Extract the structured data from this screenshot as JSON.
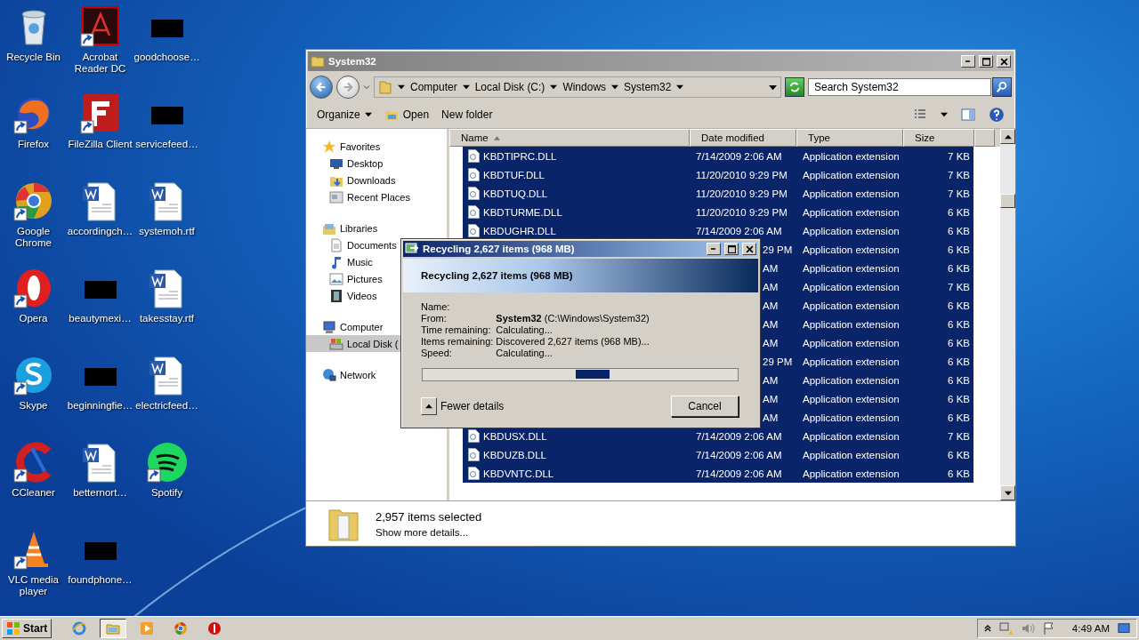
{
  "desktop_icons": [
    {
      "label": "Recycle Bin",
      "kind": "recycle",
      "shortcut": false
    },
    {
      "label": "Acrobat Reader DC",
      "kind": "acrobat",
      "shortcut": true
    },
    {
      "label": "goodchoose…",
      "kind": "blank",
      "shortcut": false
    },
    {
      "label": "Firefox",
      "kind": "firefox",
      "shortcut": true
    },
    {
      "label": "FileZilla Client",
      "kind": "filezilla",
      "shortcut": true
    },
    {
      "label": "servicefeed…",
      "kind": "blank",
      "shortcut": false
    },
    {
      "label": "Google Chrome",
      "kind": "chrome",
      "shortcut": true
    },
    {
      "label": "accordingch…",
      "kind": "word",
      "shortcut": false
    },
    {
      "label": "systemoh.rtf",
      "kind": "word",
      "shortcut": false
    },
    {
      "label": "Opera",
      "kind": "opera",
      "shortcut": true
    },
    {
      "label": "beautymexi…",
      "kind": "blank",
      "shortcut": false
    },
    {
      "label": "takesstay.rtf",
      "kind": "word",
      "shortcut": false
    },
    {
      "label": "Skype",
      "kind": "skype",
      "shortcut": true
    },
    {
      "label": "beginningfie…",
      "kind": "blank",
      "shortcut": false
    },
    {
      "label": "electricfeed…",
      "kind": "word",
      "shortcut": false
    },
    {
      "label": "CCleaner",
      "kind": "ccleaner",
      "shortcut": true
    },
    {
      "label": "betternort…",
      "kind": "word",
      "shortcut": false
    },
    {
      "label": "Spotify",
      "kind": "spotify",
      "shortcut": true
    },
    {
      "label": "VLC media player",
      "kind": "vlc",
      "shortcut": true
    },
    {
      "label": "foundphone…",
      "kind": "blank",
      "shortcut": false
    }
  ],
  "explorer": {
    "title": "System32",
    "breadcrumbs": [
      "Computer",
      "Local Disk (C:)",
      "Windows",
      "System32"
    ],
    "search": {
      "placeholder": "Search System32"
    },
    "toolbar": [
      {
        "label": "Organize",
        "kind": "menu"
      },
      {
        "label": "Open",
        "kind": "open"
      },
      {
        "label": "New folder",
        "kind": "plain"
      }
    ],
    "nav": [
      {
        "label": "Favorites",
        "kind": "star",
        "selected": false,
        "children": [
          {
            "label": "Desktop",
            "kind": "desktop",
            "selected": false
          },
          {
            "label": "Downloads",
            "kind": "downloads",
            "selected": false
          },
          {
            "label": "Recent Places",
            "kind": "recent",
            "selected": false
          }
        ]
      },
      {
        "label": "Libraries",
        "kind": "libraries",
        "selected": false,
        "children": [
          {
            "label": "Documents",
            "kind": "documents",
            "selected": false
          },
          {
            "label": "Music",
            "kind": "music",
            "selected": false
          },
          {
            "label": "Pictures",
            "kind": "pictures",
            "selected": false
          },
          {
            "label": "Videos",
            "kind": "videos",
            "selected": false
          }
        ]
      },
      {
        "label": "Computer",
        "kind": "computer",
        "selected": false,
        "children": [
          {
            "label": "Local Disk (",
            "kind": "disk",
            "selected": true
          }
        ]
      },
      {
        "label": "Network",
        "kind": "network",
        "selected": false
      }
    ],
    "columns": [
      {
        "label": "Name",
        "sorted": true
      },
      {
        "label": "Date modified",
        "sorted": false
      },
      {
        "label": "Type",
        "sorted": false
      },
      {
        "label": "Size",
        "sorted": false
      }
    ],
    "files": [
      {
        "kind": "file",
        "name": "KBDTIPRC.DLL",
        "date": "7/14/2009 2:06 AM",
        "type": "Application extension",
        "size": "7 KB",
        "selected": true
      },
      {
        "kind": "file",
        "name": "KBDTUF.DLL",
        "date": "11/20/2010 9:29 PM",
        "type": "Application extension",
        "size": "7 KB",
        "selected": true
      },
      {
        "kind": "file",
        "name": "KBDTUQ.DLL",
        "date": "11/20/2010 9:29 PM",
        "type": "Application extension",
        "size": "7 KB",
        "selected": true
      },
      {
        "kind": "file",
        "name": "KBDTURME.DLL",
        "date": "11/20/2010 9:29 PM",
        "type": "Application extension",
        "size": "6 KB",
        "selected": true
      },
      {
        "kind": "file",
        "name": "KBDUGHR.DLL",
        "date": "7/14/2009 2:06 AM",
        "type": "Application extension",
        "size": "6 KB",
        "selected": true
      },
      {
        "kind": "covered",
        "date": "29 PM",
        "type": "Application extension",
        "size": "6 KB",
        "selected": true
      },
      {
        "kind": "covered",
        "date": "AM",
        "type": "Application extension",
        "size": "6 KB",
        "selected": true
      },
      {
        "kind": "covered",
        "date": "AM",
        "type": "Application extension",
        "size": "7 KB",
        "selected": true
      },
      {
        "kind": "covered",
        "date": "AM",
        "type": "Application extension",
        "size": "6 KB",
        "selected": true
      },
      {
        "kind": "covered",
        "date": "AM",
        "type": "Application extension",
        "size": "6 KB",
        "selected": true
      },
      {
        "kind": "covered",
        "date": "AM",
        "type": "Application extension",
        "size": "6 KB",
        "selected": true
      },
      {
        "kind": "covered",
        "date": "29 PM",
        "type": "Application extension",
        "size": "6 KB",
        "selected": true
      },
      {
        "kind": "covered",
        "date": "AM",
        "type": "Application extension",
        "size": "6 KB",
        "selected": true
      },
      {
        "kind": "covered",
        "date": "AM",
        "type": "Application extension",
        "size": "6 KB",
        "selected": true
      },
      {
        "kind": "covered",
        "date": "AM",
        "type": "Application extension",
        "size": "6 KB",
        "selected": true
      },
      {
        "kind": "file",
        "name": "KBDUSX.DLL",
        "date": "7/14/2009 2:06 AM",
        "type": "Application extension",
        "size": "7 KB",
        "selected": true
      },
      {
        "kind": "file",
        "name": "KBDUZB.DLL",
        "date": "7/14/2009 2:06 AM",
        "type": "Application extension",
        "size": "6 KB",
        "selected": true
      },
      {
        "kind": "file",
        "name": "KBDVNTC.DLL",
        "date": "7/14/2009 2:06 AM",
        "type": "Application extension",
        "size": "6 KB",
        "selected": true
      }
    ],
    "details": {
      "count": "2,957 items selected",
      "link": "Show more details..."
    }
  },
  "dialog": {
    "title": "Recycling 2,627 items (968 MB)",
    "heading": "Recycling 2,627 items (968 MB)",
    "fields": [
      {
        "label": "Name:"
      },
      {
        "label": "From:",
        "value": "**System32** (C:\\Windows\\System32)"
      },
      {
        "label": "Time remaining:",
        "value": "Calculating..."
      },
      {
        "label": "Items remaining:",
        "value": "Discovered 2,627 items (968 MB)..."
      },
      {
        "label": "Speed:",
        "value": "Calculating..."
      }
    ],
    "toggle": "Fewer details",
    "cancel": "Cancel"
  },
  "taskbar": {
    "start": "Start",
    "apps": [
      {
        "kind": "ie",
        "selected": false
      },
      {
        "kind": "explorer",
        "selected": true
      },
      {
        "kind": "media",
        "selected": false
      },
      {
        "kind": "chrome",
        "selected": false
      },
      {
        "kind": "stop",
        "selected": false
      }
    ],
    "clock": "4:49 AM"
  }
}
